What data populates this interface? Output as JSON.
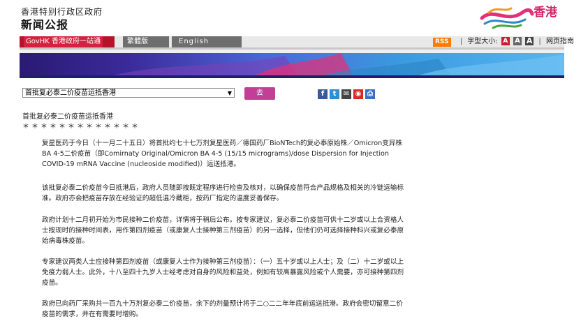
{
  "header": {
    "government": "香港特别行政区政府",
    "title": "新闻公报",
    "logo_text": "香港"
  },
  "nav": {
    "govhk": "GovHK 香港政府一站通",
    "traditional": "繁體版",
    "english": "English",
    "rss": "RSS",
    "font_size_label": "字型大小:",
    "font_a": "A",
    "text_only": "网页指南"
  },
  "toolbar": {
    "select_value": "首批复必泰二价疫苗运抵香港",
    "go_label": "去"
  },
  "article": {
    "headline": "首批复必泰二价疫苗运抵香港",
    "stars": "＊＊＊＊＊＊＊＊＊＊＊＊＊",
    "paragraphs": [
      "复星医药于今日（十一月二十五日）将首批约七十七万剂复星医药／德国药厂BioNTech的复必泰原始株／Omicron变异株BA 4-5二价疫苗（即Comirnaty Original/Omicron BA 4-5 (15/15 micrograms)/dose Dispersion for Injection COVID-19 mRNA Vaccine (nucleoside modified)）运送抵港。",
      "该批复必泰二价疫苗今日抵港后，政府人员随即按既定程序进行检查及核对，以确保疫苗符合产品规格及相关的冷链运输标准。政府亦会把疫苗存放在经验证的超低温冷藏柜，按药厂指定的温度妥善保存。",
      "政府计划十二月初开始为市民接种二价疫苗，详情将于稍后公布。按专家建议，复必泰二价疫苗可供十二岁或以上合资格人士按现时的接种时间表，用作第四剂疫苗（或康复人士接种第三剂疫苗）的另一选择，但他们仍可选择接种科兴或复必泰原始病毒株疫苗。",
      "专家建议两类人士应接种第四剂疫苗（或康复人士作为接种第三剂疫苗）：（一）五十岁或以上人士；及（二）十二岁或以上免疫力弱人士。此外，十八至四十九岁人士经考虑对自身的风险和益处，例如有较高暴露风险或个人需要，亦可接种第四剂疫苗。",
      "政府已向药厂采购共一百九十万剂复必泰二价疫苗，余下的剂量预计将于二○二二年年底前运送抵港。政府会密切留意二价疫苗的需求，并在有需要时增购。"
    ]
  }
}
